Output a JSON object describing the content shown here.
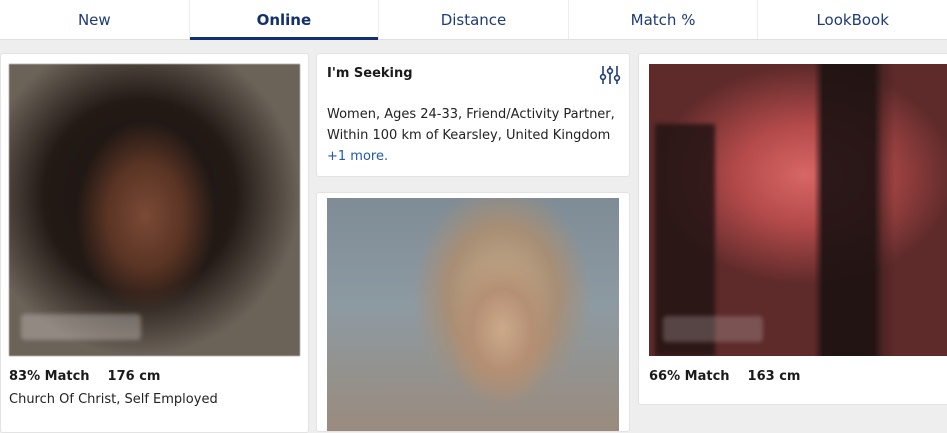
{
  "tabs": [
    {
      "label": "New",
      "active": false
    },
    {
      "label": "Online",
      "active": true
    },
    {
      "label": "Distance",
      "active": false
    },
    {
      "label": "Match %",
      "active": false
    },
    {
      "label": "LookBook",
      "active": false
    }
  ],
  "profile1": {
    "match": "83% Match",
    "height": "176 cm",
    "details": "Church Of Christ, Self Employed"
  },
  "seeking": {
    "title": "I'm Seeking",
    "text": "Women, Ages 24-33, Friend/Activity Partner, Within 100 km of Kearsley, United Kingdom",
    "more": "+1 more."
  },
  "profile3": {
    "match": "66% Match",
    "height": "163 cm"
  },
  "colors": {
    "accent": "#13306b",
    "link": "#1f58b0"
  },
  "icons": {
    "filter": "sliders-icon"
  }
}
